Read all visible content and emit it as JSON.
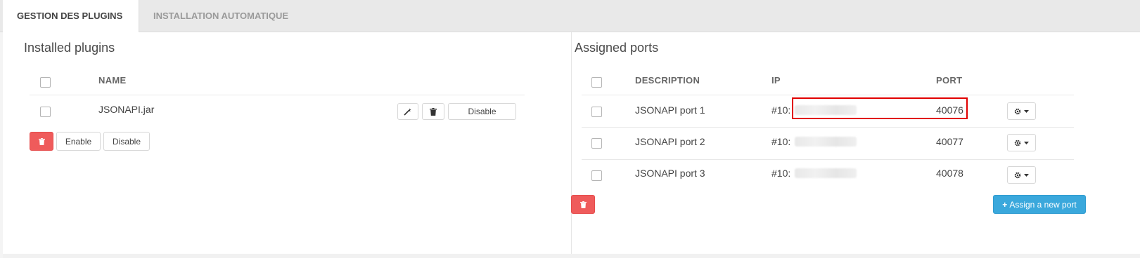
{
  "tabs": [
    {
      "label": "GESTION DES PLUGINS",
      "active": true
    },
    {
      "label": "INSTALLATION AUTOMATIQUE",
      "active": false
    }
  ],
  "installed": {
    "title": "Installed plugins",
    "header_name": "NAME",
    "rows": [
      {
        "name": "JSONAPI.jar",
        "disable_label": "Disable"
      }
    ],
    "enable_label": "Enable",
    "disable_label": "Disable"
  },
  "ports": {
    "title": "Assigned ports",
    "header_description": "DESCRIPTION",
    "header_ip": "IP",
    "header_port": "PORT",
    "rows": [
      {
        "description": "JSONAPI port 1",
        "ip_prefix": "#10:",
        "port": "40076"
      },
      {
        "description": "JSONAPI port 2",
        "ip_prefix": "#10:",
        "port": "40077"
      },
      {
        "description": "JSONAPI port 3",
        "ip_prefix": "#10:",
        "port": "40078"
      }
    ],
    "assign_label": "Assign a new port"
  },
  "colors": {
    "danger": "#ef5b5b",
    "primary": "#3aa8dc",
    "highlight": "#e10000"
  },
  "icons": {
    "edit": "magic-wand-icon",
    "delete": "trash-icon",
    "settings": "gear-icon",
    "dropdown": "caret-down-icon",
    "add": "plus-icon"
  }
}
